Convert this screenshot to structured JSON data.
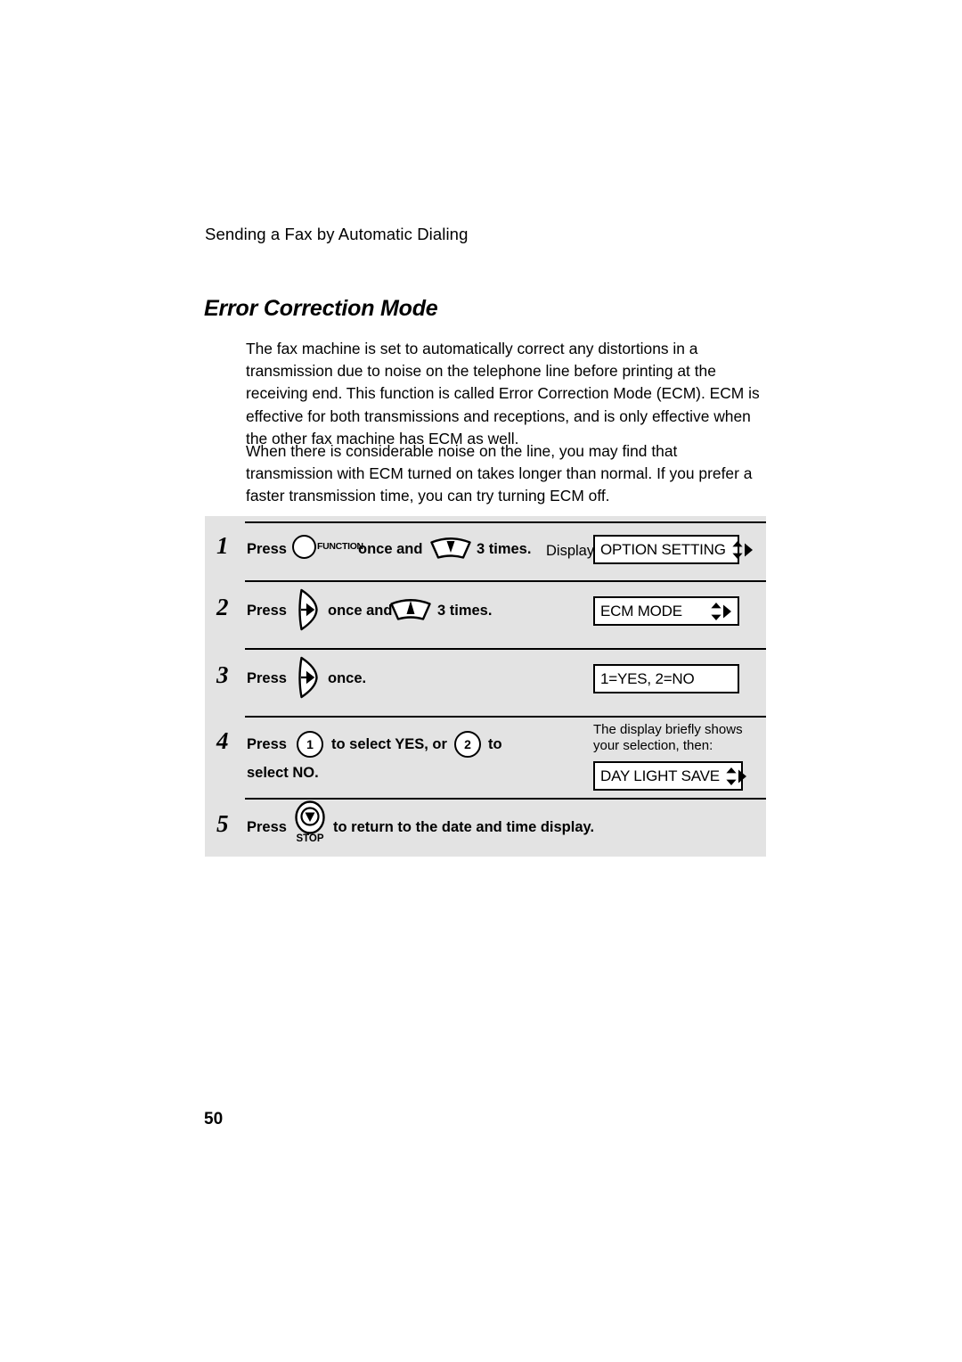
{
  "header": {
    "running_title": "Sending a Fax by Automatic Dialing"
  },
  "section": {
    "title": "Error Correction Mode"
  },
  "body": {
    "paragraph_1": "The fax machine is set to automatically correct any distortions in a transmission due to noise on the telephone line before printing at the receiving end. This function is called Error Correction Mode (ECM). ECM is effective for both transmissions and receptions, and is only effective when the other fax machine has ECM as well.",
    "paragraph_2": "When there is considerable noise on the line, you may find that transmission with ECM turned on takes longer than normal. If you prefer a faster transmission time, you can try turning ECM off."
  },
  "steps": [
    {
      "number": "1",
      "press_label": "Press",
      "function_key_label": "FUNCTION",
      "mid_text": "once and",
      "tail_text": "3 times.",
      "display_label": "Display:",
      "lcd_text": "OPTION SETTING",
      "lcd_has_arrows": true
    },
    {
      "number": "2",
      "press_label": "Press",
      "mid_text": "once and",
      "tail_text": "3 times.",
      "lcd_text": "ECM MODE",
      "lcd_has_arrows": true
    },
    {
      "number": "3",
      "press_label": "Press",
      "tail_text": "once.",
      "lcd_text": "1=YES, 2=NO",
      "lcd_has_arrows": false
    },
    {
      "number": "4",
      "press_label": "Press",
      "key_1": "1",
      "mid_text": "to select YES, or",
      "key_2": "2",
      "tail_text": "to",
      "second_line": "select NO.",
      "note_line_1": "The display briefly shows",
      "note_line_2": "your selection, then:",
      "lcd_text": "DAY LIGHT SAVE",
      "lcd_has_arrows": true
    },
    {
      "number": "5",
      "press_label": "Press",
      "stop_key_label": "STOP",
      "tail_text": "to return to the date and time display."
    }
  ],
  "footer": {
    "page_number": "50"
  },
  "colors": {
    "panel_background": "#e3e3e3",
    "text": "#000000",
    "page_background": "#ffffff"
  }
}
